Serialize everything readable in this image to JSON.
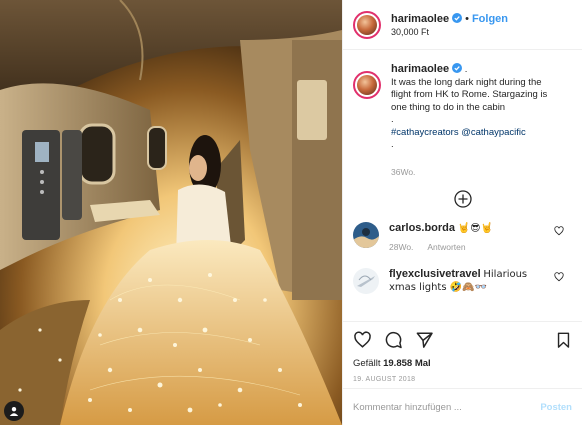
{
  "header": {
    "username": "harimaolee",
    "follow_label": "Folgen",
    "location": "30,000 Ft"
  },
  "caption": {
    "username": "harimaolee",
    "lines": [
      "It was the long dark night during the",
      "flight from HK to Rome. Stargazing is",
      "one thing to do in the cabin",
      "."
    ],
    "hashtags": "#cathaycreators @cathaypacific",
    "trailing": ".",
    "time": "36Wo."
  },
  "comments": [
    {
      "username": "carlos.borda",
      "text": "🤘😎🤘",
      "time": "28Wo.",
      "reply_label": "Antworten"
    },
    {
      "username": "flyexclusivetravel",
      "text": "Hilarious xmas lights 🤣🙈👓"
    }
  ],
  "likes": {
    "prefix": "Gefällt",
    "count": "19.858",
    "suffix": "Mal"
  },
  "date": "19. AUGUST 2018",
  "comment_input": {
    "placeholder": "Kommentar hinzufügen ..."
  },
  "post_button_label": "Posten",
  "colors": {
    "link": "#3897f0",
    "hashtag": "#003569",
    "muted": "#999999",
    "post_disabled": "#b2dffc"
  },
  "icons": [
    "verified-icon",
    "heart-icon",
    "comment-icon",
    "share-icon",
    "bookmark-icon",
    "add-circle-icon",
    "user-tag-icon"
  ]
}
